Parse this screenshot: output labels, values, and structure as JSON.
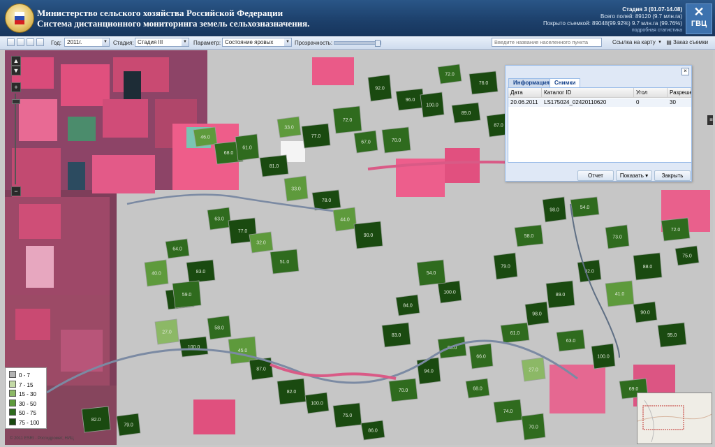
{
  "header": {
    "title_line1": "Министерство сельского хозяйства Российской Федерации",
    "title_line2": "Система дистанционного мониторинга земель сельхозназначения.",
    "stage": "Стадия 3 (01.07-14.08)",
    "total_fields": "Всего полей: 89120 (9.7 млн.га)",
    "coverage": "Покрыто съемкой: 89048(99.92%) 9.7 млн.га (99.76%)",
    "stats_link": "подробная статистика",
    "logo_text": "ГВЦ"
  },
  "toolbar": {
    "year_label": "Год:",
    "year_value": "2011г.",
    "stage_label": "Стадия:",
    "stage_value": "Стадия III",
    "param_label": "Параметр:",
    "param_value": "Состояние яровых",
    "transparency_label": "Прозрачность:",
    "search_placeholder": "Введите название населенного пункта",
    "link_button": "Ссылка на карту",
    "order_button": "Заказ съемки"
  },
  "dialog": {
    "tab_info": "Информация",
    "tab_images": "Снимки",
    "columns": [
      "Дата",
      "Каталог ID",
      "Угол",
      "Разрешен"
    ],
    "row": {
      "date": "20.06.2011",
      "catalog_id": "LS175024_02420110620",
      "angle": "0",
      "resolution": "30"
    },
    "btn_report": "Отчет",
    "btn_show": "Показать",
    "btn_close": "Закрыть"
  },
  "legend": [
    {
      "label": "0 - 7",
      "color": "#b3b3b3"
    },
    {
      "label": "7 - 15",
      "color": "#c3d9a6"
    },
    {
      "label": "15 - 30",
      "color": "#8cb866"
    },
    {
      "label": "30 - 50",
      "color": "#5e9a3c"
    },
    {
      "label": "50 - 75",
      "color": "#2f6b1e"
    },
    {
      "label": "75 - 100",
      "color": "#1a4a10"
    }
  ],
  "copyright": "© 2011 ESRI · Росгидромет, НИЦ",
  "field_labels": [
    "72.0",
    "76.0",
    "92.0",
    "96.0",
    "100.0",
    "89.0",
    "87.0",
    "72.0",
    "67.0",
    "70.0",
    "33.0",
    "77.0",
    "46.0",
    "68.0",
    "61.0",
    "81.0",
    "33.0",
    "78.0",
    "44.0",
    "90.0",
    "63.0",
    "77.0",
    "32.0",
    "51.0",
    "64.0",
    "83.0",
    "40.0",
    "92.0",
    "27.0",
    "100.0",
    "58.0",
    "45.0",
    "87.0",
    "82.0",
    "100.0",
    "75.0",
    "86.0",
    "70.0",
    "94.0",
    "63.0",
    "66.0",
    "61.0",
    "98.0",
    "89.0",
    "92.0",
    "41.0",
    "90.0",
    "95.0",
    "75.0",
    "72.0",
    "79.0",
    "58.0",
    "98.0",
    "54.0",
    "73.0",
    "88.0",
    "100.0",
    "54.0",
    "84.0",
    "83.0",
    "68.0",
    "74.0",
    "70.0",
    "63.0",
    "100.0",
    "69.0",
    "27.0",
    "59.0",
    "79.0",
    "82.0"
  ]
}
